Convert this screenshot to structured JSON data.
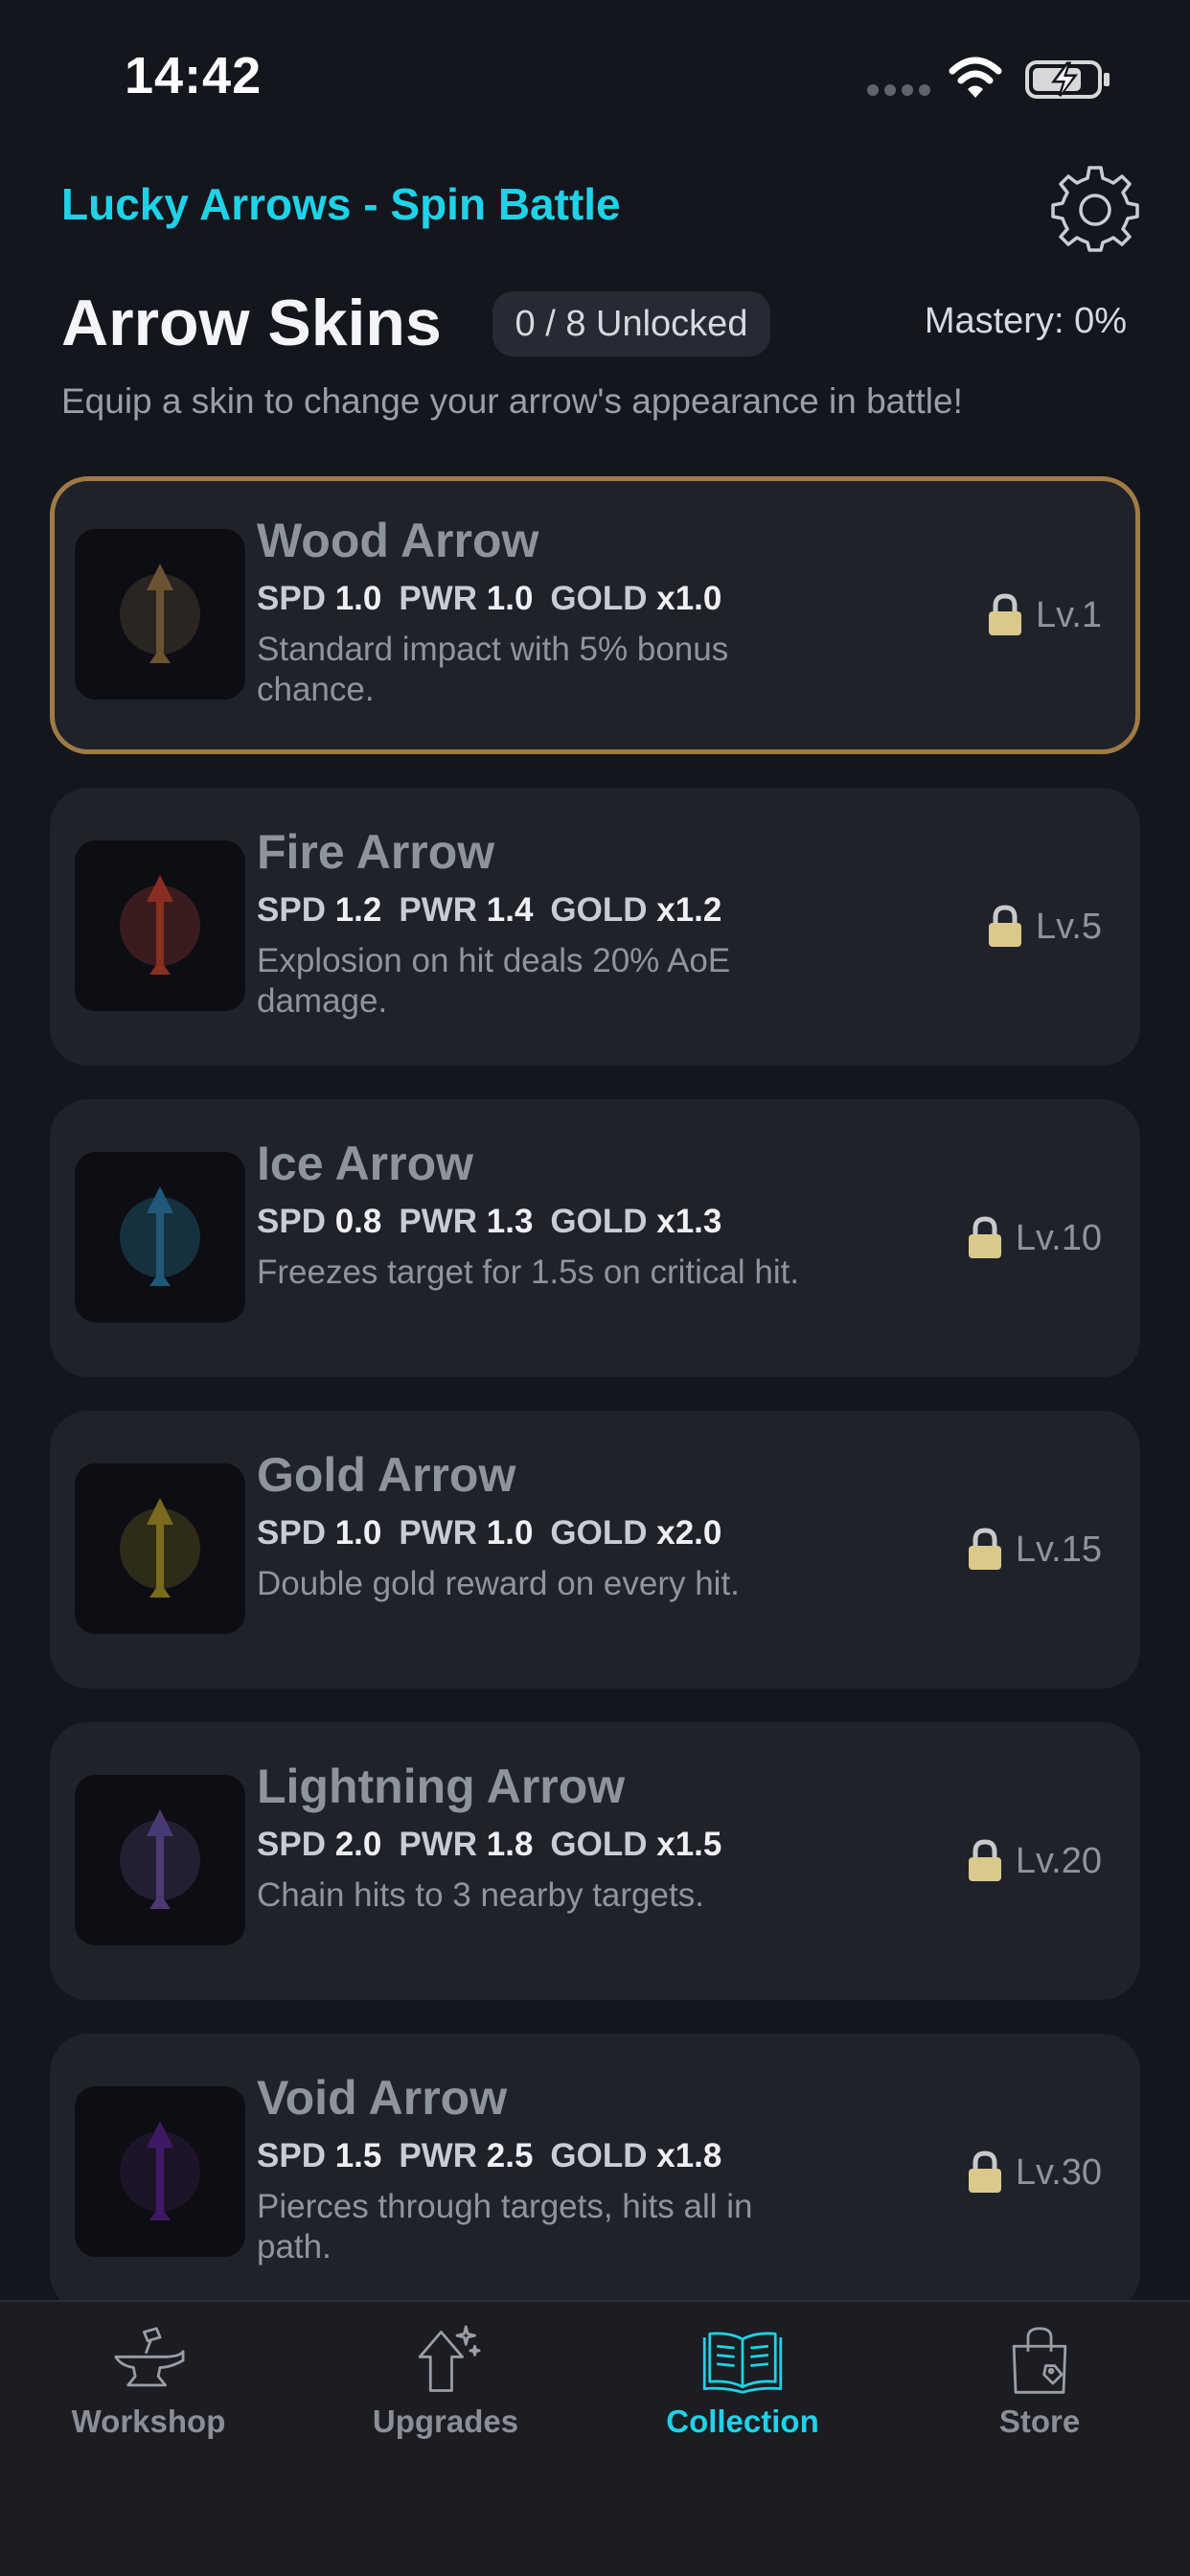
{
  "status_bar": {
    "time": "14:42"
  },
  "header": {
    "app_title": "Lucky Arrows - Spin Battle",
    "settings_icon": "gear-icon"
  },
  "page": {
    "title": "Arrow Skins",
    "unlocked_badge": "0 / 8 Unlocked",
    "mastery": "Mastery: 0%",
    "subtitle": "Equip a skin to change your arrow's appearance in battle!"
  },
  "skins": [
    {
      "name": "Wood Arrow",
      "spd_label": "SPD",
      "spd": "1.0",
      "pwr_label": "PWR",
      "pwr": "1.0",
      "gold_label": "GOLD",
      "gold": "x1.0",
      "description": "Standard impact with 5% bonus chance.",
      "level": "Lv.1",
      "selected": true,
      "color": "#6b5232",
      "glow": "#2a2520"
    },
    {
      "name": "Fire Arrow",
      "spd_label": "SPD",
      "spd": "1.2",
      "pwr_label": "PWR",
      "pwr": "1.4",
      "gold_label": "GOLD",
      "gold": "x1.2",
      "description": "Explosion on hit deals 20% AoE damage.",
      "level": "Lv.5",
      "selected": false,
      "color": "#8a2e22",
      "glow": "#3a1c1f"
    },
    {
      "name": "Ice Arrow",
      "spd_label": "SPD",
      "spd": "0.8",
      "pwr_label": "PWR",
      "pwr": "1.3",
      "gold_label": "GOLD",
      "gold": "x1.3",
      "description": "Freezes target for 1.5s on critical hit.",
      "level": "Lv.10",
      "selected": false,
      "color": "#1f5878",
      "glow": "#17303d"
    },
    {
      "name": "Gold Arrow",
      "spd_label": "SPD",
      "spd": "1.0",
      "pwr_label": "PWR",
      "pwr": "1.0",
      "gold_label": "GOLD",
      "gold": "x2.0",
      "description": "Double gold reward on every hit.",
      "level": "Lv.15",
      "selected": false,
      "color": "#7a6a1c",
      "glow": "#2e2b18"
    },
    {
      "name": "Lightning Arrow",
      "spd_label": "SPD",
      "spd": "2.0",
      "pwr_label": "PWR",
      "pwr": "1.8",
      "gold_label": "GOLD",
      "gold": "x1.5",
      "description": "Chain hits to 3 nearby targets.",
      "level": "Lv.20",
      "selected": false,
      "color": "#4a3a72",
      "glow": "#231f33"
    },
    {
      "name": "Void Arrow",
      "spd_label": "SPD",
      "spd": "1.5",
      "pwr_label": "PWR",
      "pwr": "2.5",
      "gold_label": "GOLD",
      "gold": "x1.8",
      "description": "Pierces through targets, hits all in path.",
      "level": "Lv.30",
      "selected": false,
      "color": "#3e1a66",
      "glow": "#1e1428"
    }
  ],
  "nav": {
    "workshop": "Workshop",
    "upgrades": "Upgrades",
    "collection": "Collection",
    "store": "Store",
    "active": "collection"
  },
  "colors": {
    "accent": "#1ed3e8",
    "selected_border": "#a07a45",
    "lock": "#d9c98a"
  }
}
